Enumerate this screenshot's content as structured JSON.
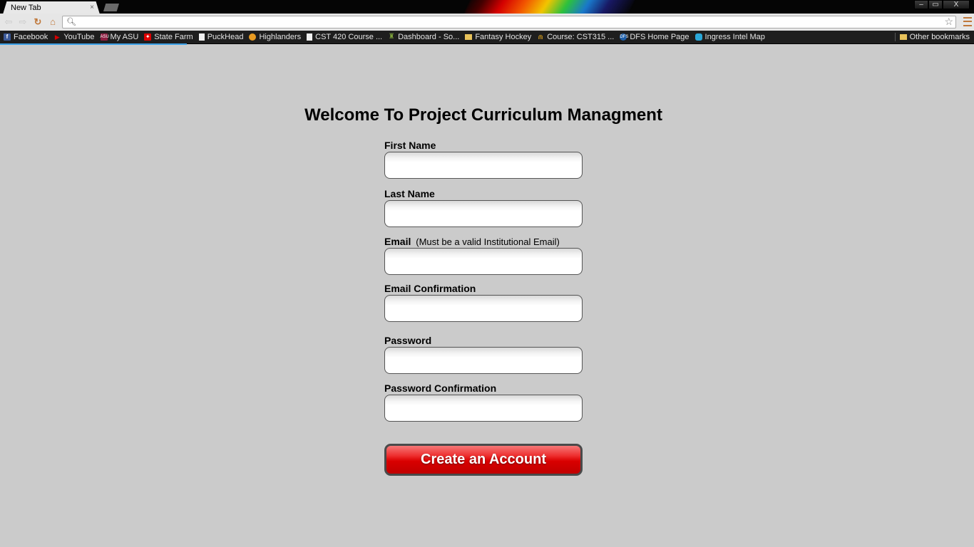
{
  "browser": {
    "tab_title": "New Tab",
    "tab_close": "×",
    "omnibox_value": "",
    "window_controls": [
      "–",
      "▭",
      "X"
    ],
    "bookmarks": [
      {
        "label": "Facebook",
        "icon": "facebook-icon"
      },
      {
        "label": "YouTube",
        "icon": "youtube-icon"
      },
      {
        "label": "My ASU",
        "icon": "asu-icon"
      },
      {
        "label": "State Farm",
        "icon": "statefarm-icon"
      },
      {
        "label": "PuckHead",
        "icon": "page-icon"
      },
      {
        "label": "Highlanders",
        "icon": "highlanders-icon"
      },
      {
        "label": "CST 420 Course ...",
        "icon": "page-icon"
      },
      {
        "label": "Dashboard - So...",
        "icon": "dashboard-icon"
      },
      {
        "label": "Fantasy Hockey",
        "icon": "folder-icon"
      },
      {
        "label": "Course: CST315 ...",
        "icon": "course-icon"
      },
      {
        "label": "DFS Home Page",
        "icon": "dfs-icon"
      },
      {
        "label": "Ingress Intel Map",
        "icon": "ingress-icon"
      }
    ],
    "other_bookmarks": "Other bookmarks"
  },
  "page": {
    "title": "Welcome To Project Curriculum Managment",
    "form": {
      "first_name_label": "First Name",
      "last_name_label": "Last Name",
      "email_label": "Email",
      "email_hint": "(Must be a valid Institutional Email)",
      "email_confirmation_label": "Email Confirmation",
      "password_label": "Password",
      "password_confirmation_label": "Password Confirmation",
      "submit_label": "Create an Account"
    }
  },
  "colors": {
    "page_background": "#cbcbcb",
    "button_red": "#d90000",
    "load_bar": "#3aa0e6"
  }
}
